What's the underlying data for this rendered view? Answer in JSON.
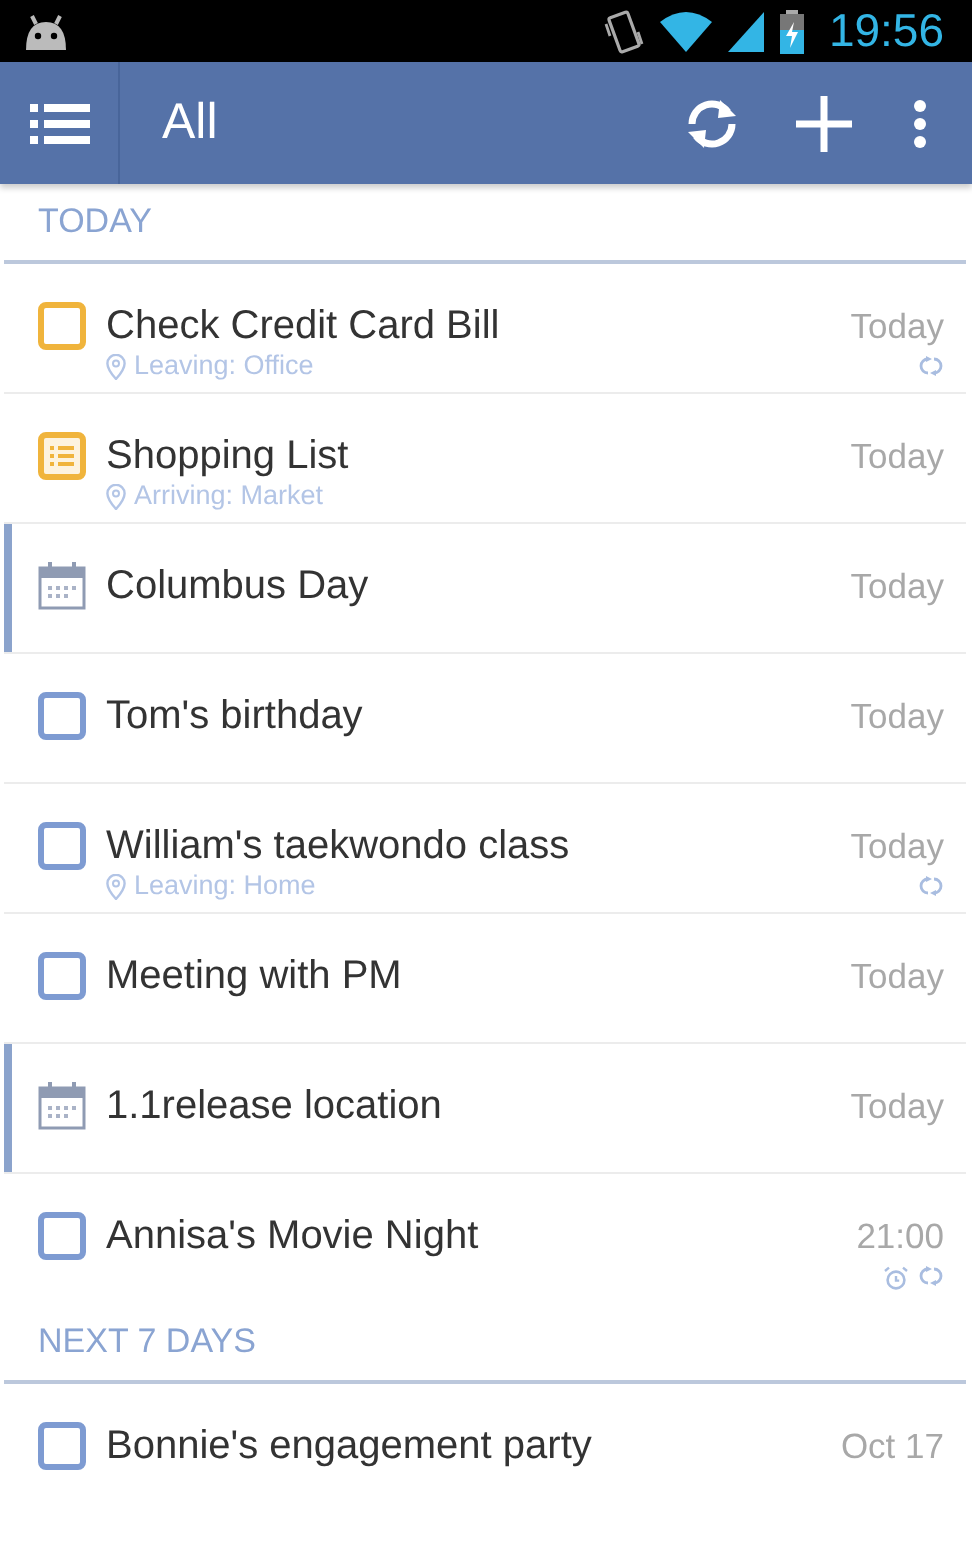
{
  "status_bar": {
    "time": "19:56"
  },
  "toolbar": {
    "title": "All"
  },
  "sections": [
    {
      "header": "TODAY",
      "items": [
        {
          "kind": "task",
          "title": "Check Credit Card Bill",
          "date": "Today",
          "location": "Leaving: Office",
          "repeat": true,
          "alarm": false,
          "color": "#f0b43c"
        },
        {
          "kind": "checklist",
          "title": "Shopping List",
          "date": "Today",
          "location": "Arriving: Market",
          "repeat": false,
          "alarm": false,
          "color": "#f0b43c"
        },
        {
          "kind": "event",
          "title": "Columbus Day",
          "date": "Today",
          "repeat": false,
          "alarm": false
        },
        {
          "kind": "task",
          "title": "Tom's birthday",
          "date": "Today",
          "repeat": false,
          "alarm": false,
          "color": "#7e9bd2"
        },
        {
          "kind": "task",
          "title": "William's taekwondo class",
          "date": "Today",
          "location": "Leaving: Home",
          "repeat": true,
          "alarm": false,
          "color": "#7e9bd2"
        },
        {
          "kind": "task",
          "title": "Meeting with PM",
          "date": "Today",
          "repeat": false,
          "alarm": false,
          "color": "#7e9bd2"
        },
        {
          "kind": "event",
          "title": "1.1release location",
          "date": "Today",
          "repeat": false,
          "alarm": false
        },
        {
          "kind": "task",
          "title": "Annisa's Movie Night",
          "date": "21:00",
          "repeat": true,
          "alarm": true,
          "color": "#7e9bd2"
        }
      ]
    },
    {
      "header": "NEXT 7 DAYS",
      "items": [
        {
          "kind": "task",
          "title": "Bonnie's engagement party",
          "date": "Oct 17",
          "repeat": false,
          "alarm": false,
          "color": "#7e9bd2"
        }
      ]
    }
  ]
}
